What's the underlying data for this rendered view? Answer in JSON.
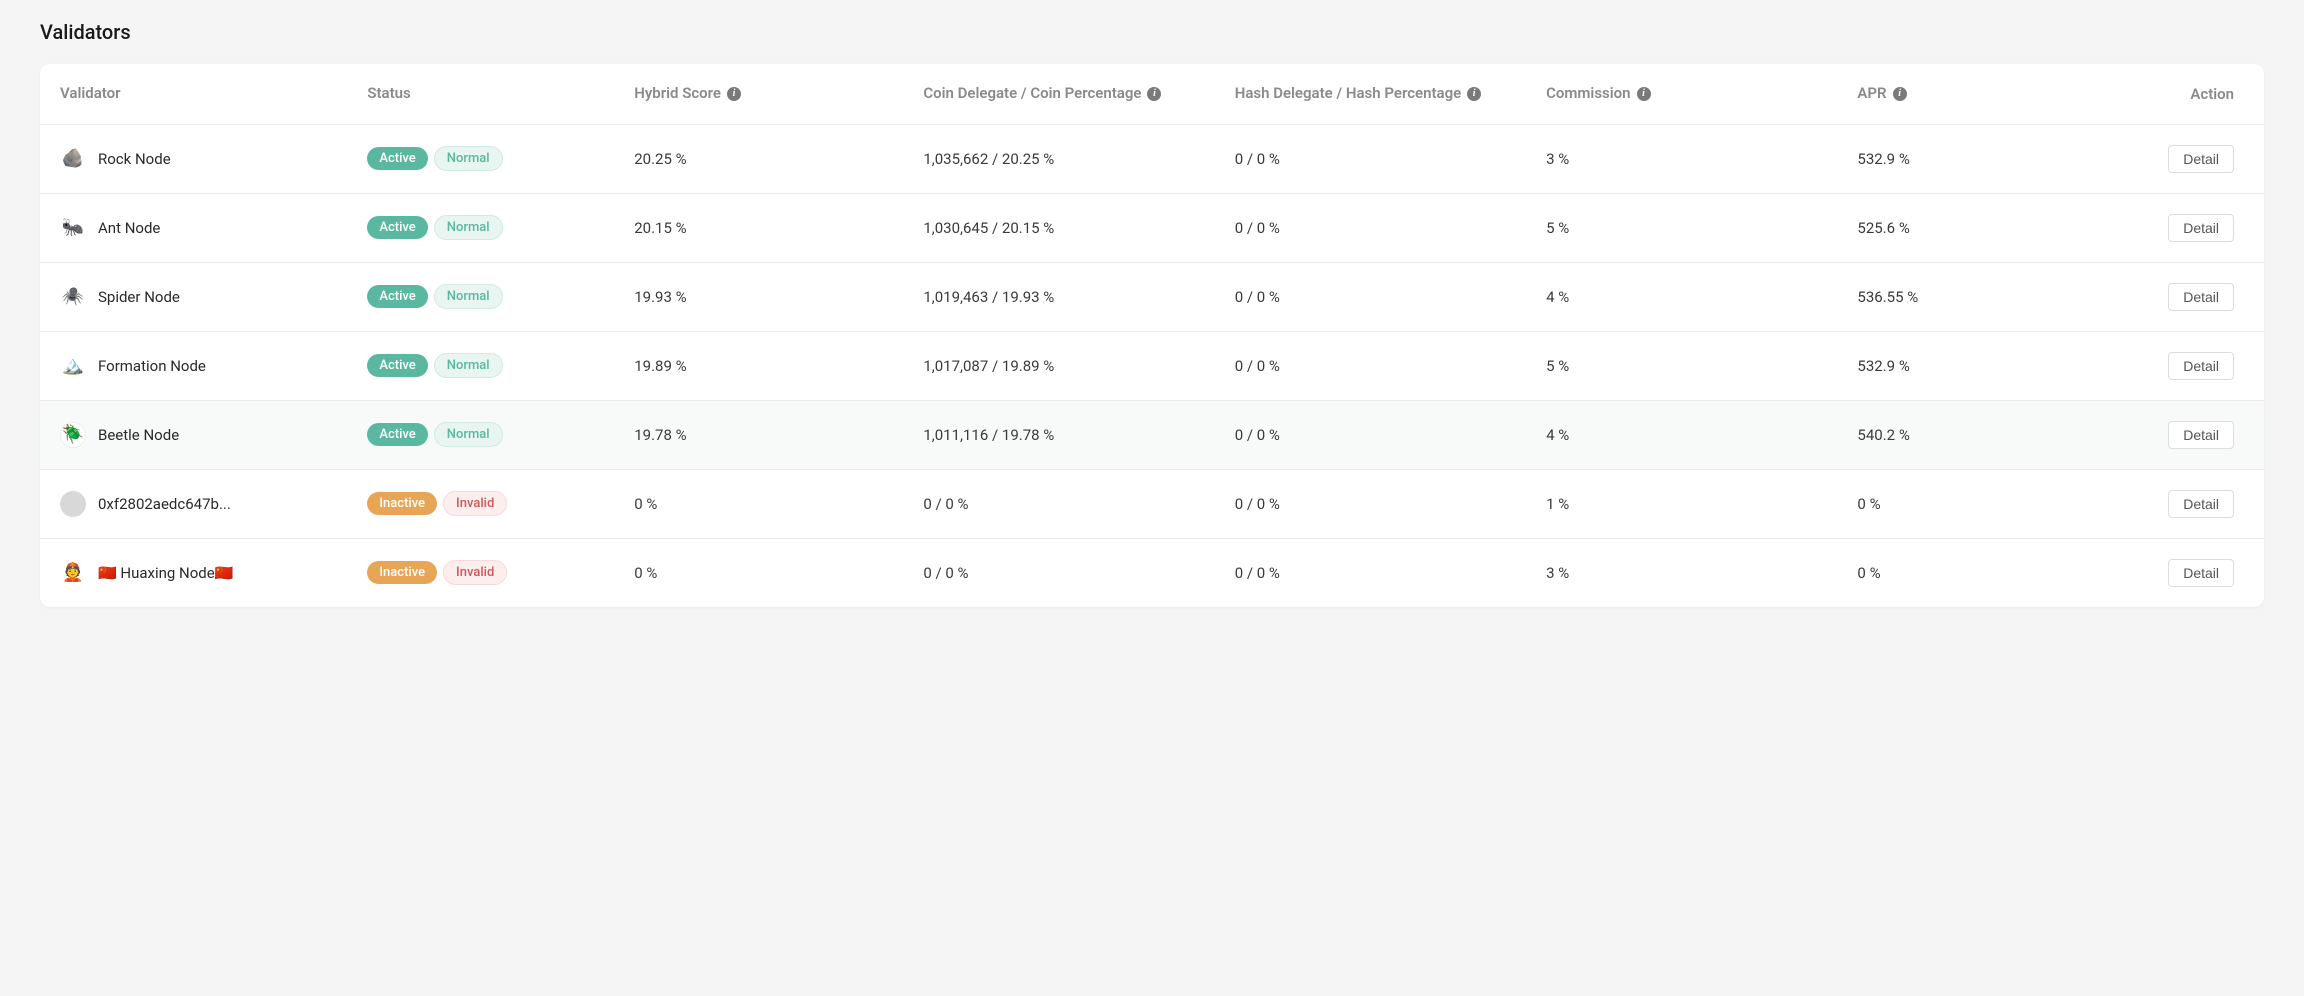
{
  "page_title": "Validators",
  "headers": {
    "validator": "Validator",
    "status": "Status",
    "hybrid_score": "Hybrid Score",
    "coin_delegate": "Coin Delegate / Coin Percentage",
    "hash_delegate": "Hash Delegate / Hash Percentage",
    "commission": "Commission",
    "apr": "APR",
    "action": "Action"
  },
  "detail_button_label": "Detail",
  "rows": [
    {
      "icon": "🪨",
      "icon_bg": "",
      "name": "Rock Node",
      "status": "Active",
      "sub_status": "Normal",
      "hybrid_score": "20.25 %",
      "coin_delegate": "1,035,662 / 20.25 %",
      "hash_delegate": "0 / 0 %",
      "commission": "3 %",
      "apr": "532.9 %",
      "highlighted": false
    },
    {
      "icon": "🐜",
      "icon_bg": "",
      "name": "Ant Node",
      "status": "Active",
      "sub_status": "Normal",
      "hybrid_score": "20.15 %",
      "coin_delegate": "1,030,645 / 20.15 %",
      "hash_delegate": "0 / 0 %",
      "commission": "5 %",
      "apr": "525.6 %",
      "highlighted": false
    },
    {
      "icon": "🕷️",
      "icon_bg": "",
      "name": "Spider Node",
      "status": "Active",
      "sub_status": "Normal",
      "hybrid_score": "19.93 %",
      "coin_delegate": "1,019,463 / 19.93 %",
      "hash_delegate": "0 / 0 %",
      "commission": "4 %",
      "apr": "536.55 %",
      "highlighted": false
    },
    {
      "icon": "🏔️",
      "icon_bg": "",
      "name": "Formation Node",
      "status": "Active",
      "sub_status": "Normal",
      "hybrid_score": "19.89 %",
      "coin_delegate": "1,017,087 / 19.89 %",
      "hash_delegate": "0 / 0 %",
      "commission": "5 %",
      "apr": "532.9 %",
      "highlighted": false
    },
    {
      "icon": "🪲",
      "icon_bg": "white",
      "name": "Beetle Node",
      "status": "Active",
      "sub_status": "Normal",
      "hybrid_score": "19.78 %",
      "coin_delegate": "1,011,116 / 19.78 %",
      "hash_delegate": "0 / 0 %",
      "commission": "4 %",
      "apr": "540.2 %",
      "highlighted": true
    },
    {
      "icon": "",
      "icon_bg": "gray",
      "name": "0xf2802aedc647b...",
      "status": "Inactive",
      "sub_status": "Invalid",
      "hybrid_score": "0 %",
      "coin_delegate": "0 / 0 %",
      "hash_delegate": "0 / 0 %",
      "commission": "1 %",
      "apr": "0 %",
      "highlighted": false
    },
    {
      "icon": "👲",
      "icon_bg": "",
      "name": "🇨🇳 Huaxing Node🇨🇳",
      "status": "Inactive",
      "sub_status": "Invalid",
      "hybrid_score": "0 %",
      "coin_delegate": "0 / 0 %",
      "hash_delegate": "0 / 0 %",
      "commission": "3 %",
      "apr": "0 %",
      "highlighted": false
    }
  ]
}
